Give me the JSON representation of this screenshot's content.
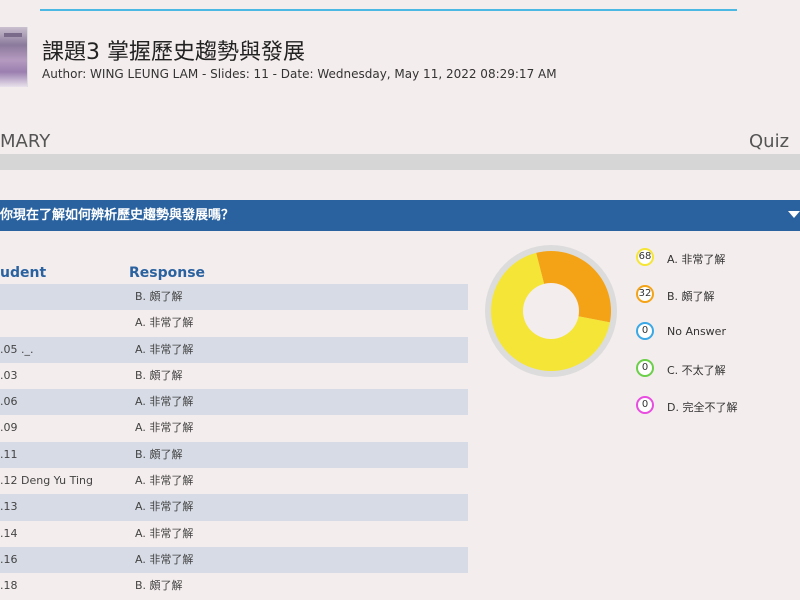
{
  "header": {
    "title": "課題3 掌握歷史趨勢與發展",
    "meta": "Author: WING LEUNG LAM - Slides: 11 - Date: Wednesday, May 11, 2022 08:29:17 AM"
  },
  "tabs": {
    "summary": "MARY",
    "quiz": "Quiz"
  },
  "question": {
    "text": "你現在了解如何辨析歷史趨勢與發展嗎？"
  },
  "table": {
    "headers": {
      "student": "udent",
      "response": "Response"
    },
    "rows": [
      {
        "student": "",
        "response": "B. 頗了解"
      },
      {
        "student": "",
        "response": "A. 非常了解"
      },
      {
        "student": ".05 ._.",
        "response": "A. 非常了解"
      },
      {
        "student": ".03",
        "response": "B. 頗了解"
      },
      {
        "student": ".06",
        "response": "A. 非常了解"
      },
      {
        "student": ".09",
        "response": "A. 非常了解"
      },
      {
        "student": ".11",
        "response": "B. 頗了解"
      },
      {
        "student": ".12 Deng Yu Ting",
        "response": "A. 非常了解"
      },
      {
        "student": ".13",
        "response": "A. 非常了解"
      },
      {
        "student": ".14",
        "response": "A. 非常了解"
      },
      {
        "student": ".16",
        "response": "A. 非常了解"
      },
      {
        "student": ".18",
        "response": "B. 頗了解"
      }
    ]
  },
  "legend": [
    {
      "count": "68",
      "label": "A. 非常了解",
      "color": "#f5e536"
    },
    {
      "count": "32",
      "label": "B. 頗了解",
      "color": "#f5a316"
    },
    {
      "count": "0",
      "label": "No Answer",
      "color": "#3aa8e6"
    },
    {
      "count": "0",
      "label": "C. 不太了解",
      "color": "#6ccf4a"
    },
    {
      "count": "0",
      "label": "D. 完全不了解",
      "color": "#e84de0"
    }
  ],
  "chart_data": {
    "type": "pie",
    "categories": [
      "A. 非常了解",
      "B. 頗了解",
      "No Answer",
      "C. 不太了解",
      "D. 完全不了解"
    ],
    "values": [
      68,
      32,
      0,
      0,
      0
    ],
    "colors": [
      "#f5e536",
      "#f5a316",
      "#3aa8e6",
      "#6ccf4a",
      "#e84de0"
    ]
  }
}
